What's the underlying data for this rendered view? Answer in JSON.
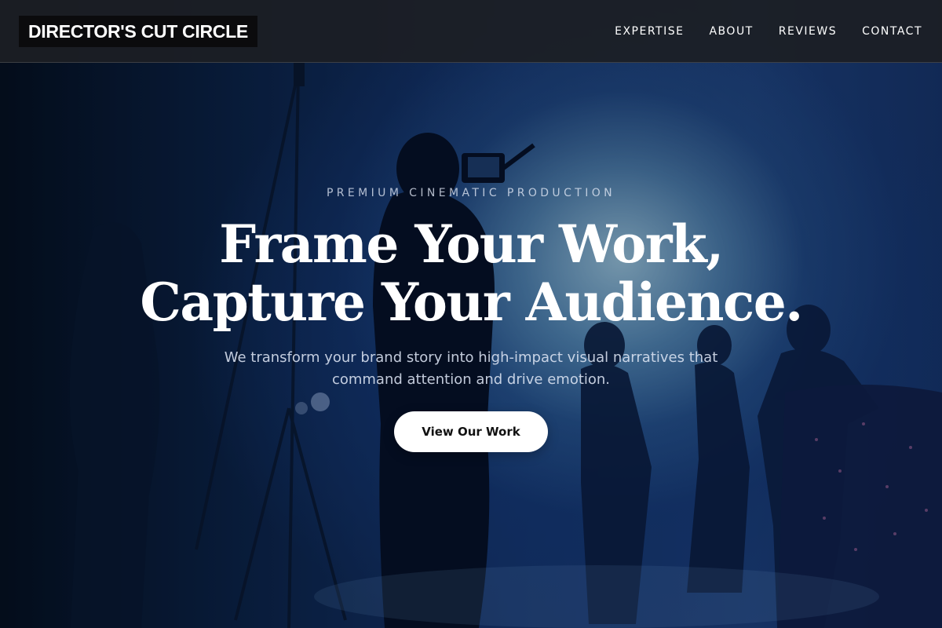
{
  "nav": {
    "logo": "DIRECTOR'S CUT CIRCLE",
    "links": [
      "EXPERTISE",
      "ABOUT",
      "REVIEWS",
      "CONTACT"
    ]
  },
  "hero": {
    "eyebrow": "PREMIUM CINEMATIC PRODUCTION",
    "headline_line1": "Frame Your Work,",
    "headline_line2": "Capture Your Audience.",
    "subhead": "We transform your brand story into high-impact visual narratives that command attention and drive emotion.",
    "cta_label": "View Our Work",
    "background_image": "film-set-silhouettes-photo"
  },
  "colors": {
    "nav_background": "#1c1e24",
    "logo_background": "#0b0b0d",
    "hero_tint": "#15336a",
    "cta_background": "#ffffff",
    "text_primary": "#ffffff"
  }
}
